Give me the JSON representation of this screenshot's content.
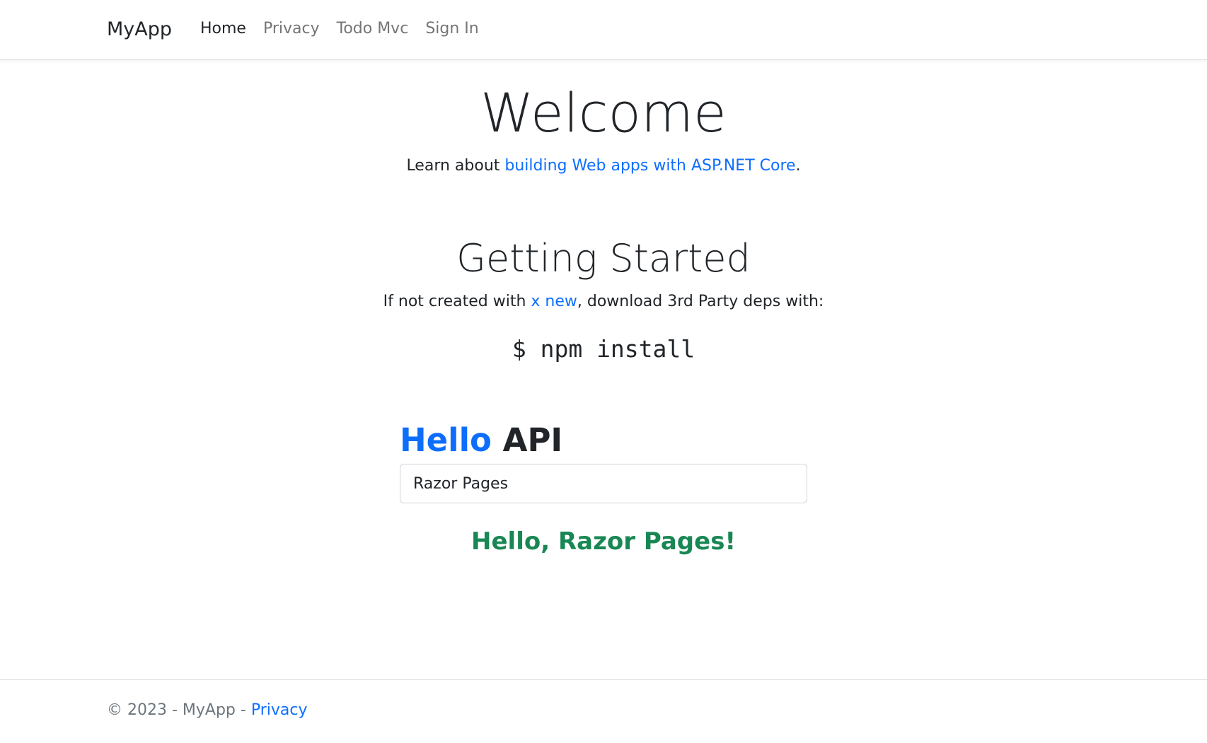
{
  "navbar": {
    "brand": "MyApp",
    "links": [
      {
        "label": "Home",
        "active": true
      },
      {
        "label": "Privacy"
      },
      {
        "label": "Todo Mvc"
      },
      {
        "label": "Sign In"
      }
    ]
  },
  "welcome": {
    "title": "Welcome",
    "lead_prefix": "Learn about ",
    "lead_link": "building Web apps with ASP.NET Core",
    "lead_suffix": "."
  },
  "getting_started": {
    "title": "Getting Started",
    "text_prefix": "If not created with ",
    "text_link": "x new",
    "text_suffix": ", download 3rd Party deps with:",
    "command": "$ npm install"
  },
  "hello_api": {
    "hello": "Hello",
    "api": "API",
    "input_value": "Razor Pages",
    "result": "Hello, Razor Pages!"
  },
  "footer": {
    "prefix": "© 2023 - MyApp - ",
    "privacy_link": "Privacy"
  },
  "colors": {
    "link": "#0d6efd",
    "success": "#198754",
    "muted": "#6c757d"
  }
}
